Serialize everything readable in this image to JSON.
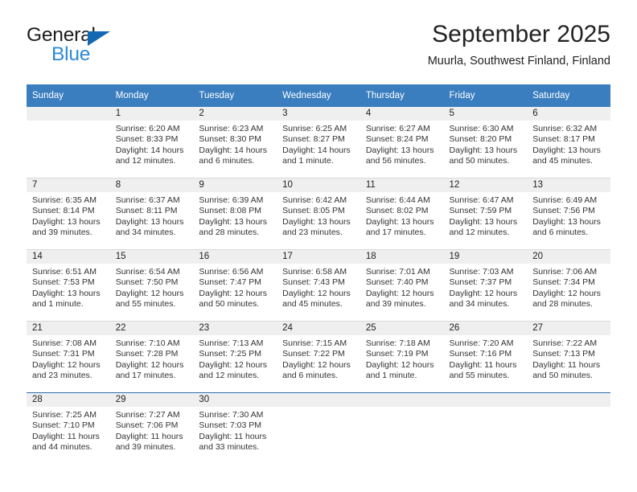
{
  "brand": {
    "name_dark": "General",
    "name_blue": "Blue",
    "accent_blue": "#2b8ad6",
    "triangle_blue": "#1268b3"
  },
  "header": {
    "title": "September 2025",
    "subtitle": "Muurla, Southwest Finland, Finland"
  },
  "calendar": {
    "header_bg": "#3a7ebf",
    "daynum_bg": "#efefef",
    "weekday_headers": [
      "Sunday",
      "Monday",
      "Tuesday",
      "Wednesday",
      "Thursday",
      "Friday",
      "Saturday"
    ],
    "weeks": [
      [
        {
          "day": ""
        },
        {
          "day": "1",
          "sunrise": "Sunrise: 6:20 AM",
          "sunset": "Sunset: 8:33 PM",
          "daylight_1": "Daylight: 14 hours",
          "daylight_2": "and 12 minutes."
        },
        {
          "day": "2",
          "sunrise": "Sunrise: 6:23 AM",
          "sunset": "Sunset: 8:30 PM",
          "daylight_1": "Daylight: 14 hours",
          "daylight_2": "and 6 minutes."
        },
        {
          "day": "3",
          "sunrise": "Sunrise: 6:25 AM",
          "sunset": "Sunset: 8:27 PM",
          "daylight_1": "Daylight: 14 hours",
          "daylight_2": "and 1 minute."
        },
        {
          "day": "4",
          "sunrise": "Sunrise: 6:27 AM",
          "sunset": "Sunset: 8:24 PM",
          "daylight_1": "Daylight: 13 hours",
          "daylight_2": "and 56 minutes."
        },
        {
          "day": "5",
          "sunrise": "Sunrise: 6:30 AM",
          "sunset": "Sunset: 8:20 PM",
          "daylight_1": "Daylight: 13 hours",
          "daylight_2": "and 50 minutes."
        },
        {
          "day": "6",
          "sunrise": "Sunrise: 6:32 AM",
          "sunset": "Sunset: 8:17 PM",
          "daylight_1": "Daylight: 13 hours",
          "daylight_2": "and 45 minutes."
        }
      ],
      [
        {
          "day": "7",
          "sunrise": "Sunrise: 6:35 AM",
          "sunset": "Sunset: 8:14 PM",
          "daylight_1": "Daylight: 13 hours",
          "daylight_2": "and 39 minutes."
        },
        {
          "day": "8",
          "sunrise": "Sunrise: 6:37 AM",
          "sunset": "Sunset: 8:11 PM",
          "daylight_1": "Daylight: 13 hours",
          "daylight_2": "and 34 minutes."
        },
        {
          "day": "9",
          "sunrise": "Sunrise: 6:39 AM",
          "sunset": "Sunset: 8:08 PM",
          "daylight_1": "Daylight: 13 hours",
          "daylight_2": "and 28 minutes."
        },
        {
          "day": "10",
          "sunrise": "Sunrise: 6:42 AM",
          "sunset": "Sunset: 8:05 PM",
          "daylight_1": "Daylight: 13 hours",
          "daylight_2": "and 23 minutes."
        },
        {
          "day": "11",
          "sunrise": "Sunrise: 6:44 AM",
          "sunset": "Sunset: 8:02 PM",
          "daylight_1": "Daylight: 13 hours",
          "daylight_2": "and 17 minutes."
        },
        {
          "day": "12",
          "sunrise": "Sunrise: 6:47 AM",
          "sunset": "Sunset: 7:59 PM",
          "daylight_1": "Daylight: 13 hours",
          "daylight_2": "and 12 minutes."
        },
        {
          "day": "13",
          "sunrise": "Sunrise: 6:49 AM",
          "sunset": "Sunset: 7:56 PM",
          "daylight_1": "Daylight: 13 hours",
          "daylight_2": "and 6 minutes."
        }
      ],
      [
        {
          "day": "14",
          "sunrise": "Sunrise: 6:51 AM",
          "sunset": "Sunset: 7:53 PM",
          "daylight_1": "Daylight: 13 hours",
          "daylight_2": "and 1 minute."
        },
        {
          "day": "15",
          "sunrise": "Sunrise: 6:54 AM",
          "sunset": "Sunset: 7:50 PM",
          "daylight_1": "Daylight: 12 hours",
          "daylight_2": "and 55 minutes."
        },
        {
          "day": "16",
          "sunrise": "Sunrise: 6:56 AM",
          "sunset": "Sunset: 7:47 PM",
          "daylight_1": "Daylight: 12 hours",
          "daylight_2": "and 50 minutes."
        },
        {
          "day": "17",
          "sunrise": "Sunrise: 6:58 AM",
          "sunset": "Sunset: 7:43 PM",
          "daylight_1": "Daylight: 12 hours",
          "daylight_2": "and 45 minutes."
        },
        {
          "day": "18",
          "sunrise": "Sunrise: 7:01 AM",
          "sunset": "Sunset: 7:40 PM",
          "daylight_1": "Daylight: 12 hours",
          "daylight_2": "and 39 minutes."
        },
        {
          "day": "19",
          "sunrise": "Sunrise: 7:03 AM",
          "sunset": "Sunset: 7:37 PM",
          "daylight_1": "Daylight: 12 hours",
          "daylight_2": "and 34 minutes."
        },
        {
          "day": "20",
          "sunrise": "Sunrise: 7:06 AM",
          "sunset": "Sunset: 7:34 PM",
          "daylight_1": "Daylight: 12 hours",
          "daylight_2": "and 28 minutes."
        }
      ],
      [
        {
          "day": "21",
          "sunrise": "Sunrise: 7:08 AM",
          "sunset": "Sunset: 7:31 PM",
          "daylight_1": "Daylight: 12 hours",
          "daylight_2": "and 23 minutes."
        },
        {
          "day": "22",
          "sunrise": "Sunrise: 7:10 AM",
          "sunset": "Sunset: 7:28 PM",
          "daylight_1": "Daylight: 12 hours",
          "daylight_2": "and 17 minutes."
        },
        {
          "day": "23",
          "sunrise": "Sunrise: 7:13 AM",
          "sunset": "Sunset: 7:25 PM",
          "daylight_1": "Daylight: 12 hours",
          "daylight_2": "and 12 minutes."
        },
        {
          "day": "24",
          "sunrise": "Sunrise: 7:15 AM",
          "sunset": "Sunset: 7:22 PM",
          "daylight_1": "Daylight: 12 hours",
          "daylight_2": "and 6 minutes."
        },
        {
          "day": "25",
          "sunrise": "Sunrise: 7:18 AM",
          "sunset": "Sunset: 7:19 PM",
          "daylight_1": "Daylight: 12 hours",
          "daylight_2": "and 1 minute."
        },
        {
          "day": "26",
          "sunrise": "Sunrise: 7:20 AM",
          "sunset": "Sunset: 7:16 PM",
          "daylight_1": "Daylight: 11 hours",
          "daylight_2": "and 55 minutes."
        },
        {
          "day": "27",
          "sunrise": "Sunrise: 7:22 AM",
          "sunset": "Sunset: 7:13 PM",
          "daylight_1": "Daylight: 11 hours",
          "daylight_2": "and 50 minutes."
        }
      ],
      [
        {
          "day": "28",
          "sunrise": "Sunrise: 7:25 AM",
          "sunset": "Sunset: 7:10 PM",
          "daylight_1": "Daylight: 11 hours",
          "daylight_2": "and 44 minutes."
        },
        {
          "day": "29",
          "sunrise": "Sunrise: 7:27 AM",
          "sunset": "Sunset: 7:06 PM",
          "daylight_1": "Daylight: 11 hours",
          "daylight_2": "and 39 minutes."
        },
        {
          "day": "30",
          "sunrise": "Sunrise: 7:30 AM",
          "sunset": "Sunset: 7:03 PM",
          "daylight_1": "Daylight: 11 hours",
          "daylight_2": "and 33 minutes."
        },
        {
          "day": ""
        },
        {
          "day": ""
        },
        {
          "day": ""
        },
        {
          "day": ""
        }
      ]
    ]
  }
}
